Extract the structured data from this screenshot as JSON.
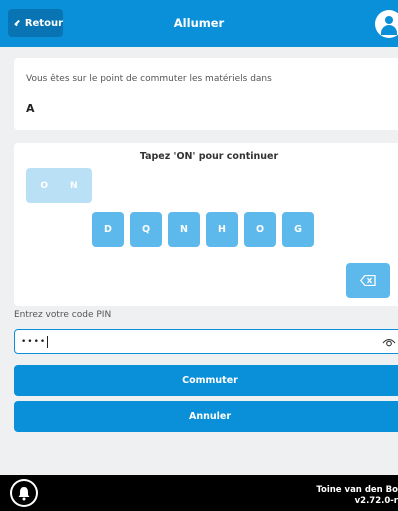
{
  "header": {
    "back_label": "Retour",
    "title": "Allumer"
  },
  "info": {
    "message": "Vous êtes sur le point de commuter les matériels dans",
    "value": "A"
  },
  "captcha": {
    "instruction": "Tapez 'ON' pour continuer",
    "typed": [
      "O",
      "N"
    ],
    "letters": [
      "D",
      "Q",
      "N",
      "H",
      "O",
      "G"
    ]
  },
  "pin": {
    "label": "Entrez votre code PIN",
    "value": "••••"
  },
  "buttons": {
    "commuter": "Commuter",
    "annuler": "Annuler"
  },
  "footer": {
    "user_name": "Toine van den Bo",
    "version": "v2.72.0-r"
  },
  "colors": {
    "primary": "#0a90d8",
    "key": "#5db8ec",
    "key_light": "#b9e0f5"
  },
  "icons": [
    "chevron-left-icon",
    "user-icon",
    "backspace-icon",
    "eye-icon",
    "bell-icon"
  ]
}
